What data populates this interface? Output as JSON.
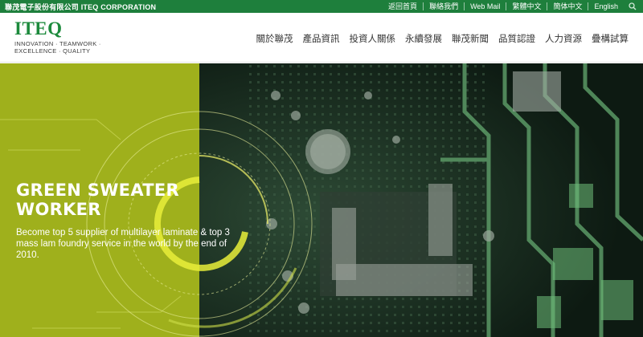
{
  "topbar": {
    "corporation": "聯茂電子股份有限公司 ITEQ CORPORATION",
    "links": [
      "返回首頁",
      "聯絡我們",
      "Web Mail",
      "繁體中文",
      "簡体中文",
      "English"
    ]
  },
  "header": {
    "logo_word": "ITEQ",
    "logo_tagline_line1": "INNOVATION · TEAMWORK ·",
    "logo_tagline_line2": "EXCELLENCE · QUALITY",
    "nav": [
      "關於聯茂",
      "產品資訊",
      "投資人關係",
      "永續發展",
      "聯茂新聞",
      "品質認證",
      "人力資源",
      "疊構試算"
    ]
  },
  "hero": {
    "title_line1": "GREEN SWEATER",
    "title_line2": "WORKER",
    "description": "Become top 5 supplier of multilayer laminate & top 3 mass lam foundry service in the world by the end of 2010."
  },
  "colors": {
    "brand_green": "#1e7f3c",
    "logo_green": "#1c8a3c",
    "hero_olive": "#9fb01c",
    "circuit_dark": "#14241b"
  }
}
